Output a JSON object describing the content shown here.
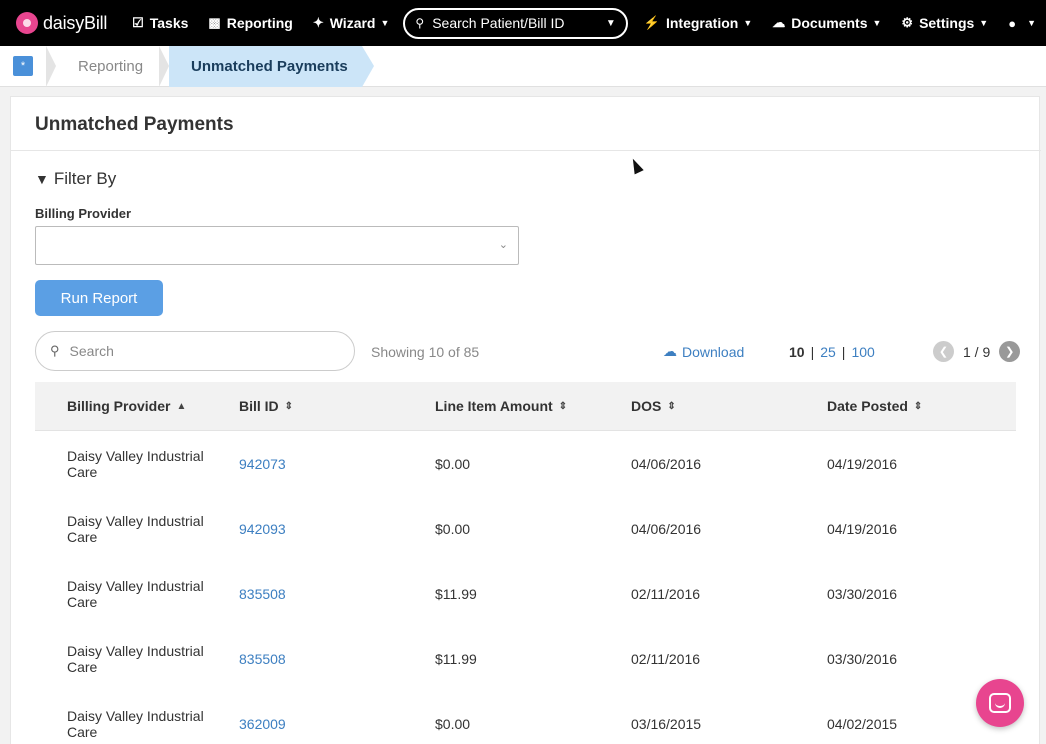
{
  "brand": {
    "name": "daisyBill"
  },
  "nav": {
    "tasks": "Tasks",
    "reporting": "Reporting",
    "wizard": "Wizard",
    "search_placeholder": "Search Patient/Bill ID",
    "integration": "Integration",
    "documents": "Documents",
    "settings": "Settings"
  },
  "breadcrumb": {
    "home_icon": "*",
    "items": [
      "Reporting",
      "Unmatched Payments"
    ]
  },
  "page": {
    "title": "Unmatched Payments"
  },
  "filter": {
    "title": "Filter By",
    "billing_provider_label": "Billing Provider",
    "billing_provider_value": "",
    "run_button": "Run Report"
  },
  "table_controls": {
    "search_placeholder": "Search",
    "showing": "Showing 10 of 85",
    "download": "Download",
    "page_sizes": [
      "10",
      "25",
      "100"
    ],
    "selected_page_size": "10",
    "pagination": "1 / 9"
  },
  "table": {
    "headers": [
      "Billing Provider",
      "Bill ID",
      "Line Item Amount",
      "DOS",
      "Date Posted"
    ],
    "rows": [
      {
        "provider": "Daisy Valley Industrial Care",
        "bill_id": "942073",
        "amount": "$0.00",
        "dos": "04/06/2016",
        "posted": "04/19/2016"
      },
      {
        "provider": "Daisy Valley Industrial Care",
        "bill_id": "942093",
        "amount": "$0.00",
        "dos": "04/06/2016",
        "posted": "04/19/2016"
      },
      {
        "provider": "Daisy Valley Industrial Care",
        "bill_id": "835508",
        "amount": "$11.99",
        "dos": "02/11/2016",
        "posted": "03/30/2016"
      },
      {
        "provider": "Daisy Valley Industrial Care",
        "bill_id": "835508",
        "amount": "$11.99",
        "dos": "02/11/2016",
        "posted": "03/30/2016"
      },
      {
        "provider": "Daisy Valley Industrial Care",
        "bill_id": "362009",
        "amount": "$0.00",
        "dos": "03/16/2015",
        "posted": "04/02/2015"
      }
    ]
  },
  "colors": {
    "brand_pink": "#e8458f",
    "link_blue": "#3d7fc1",
    "button_blue": "#5b9fe4",
    "breadcrumb_active": "#cce5f8"
  }
}
